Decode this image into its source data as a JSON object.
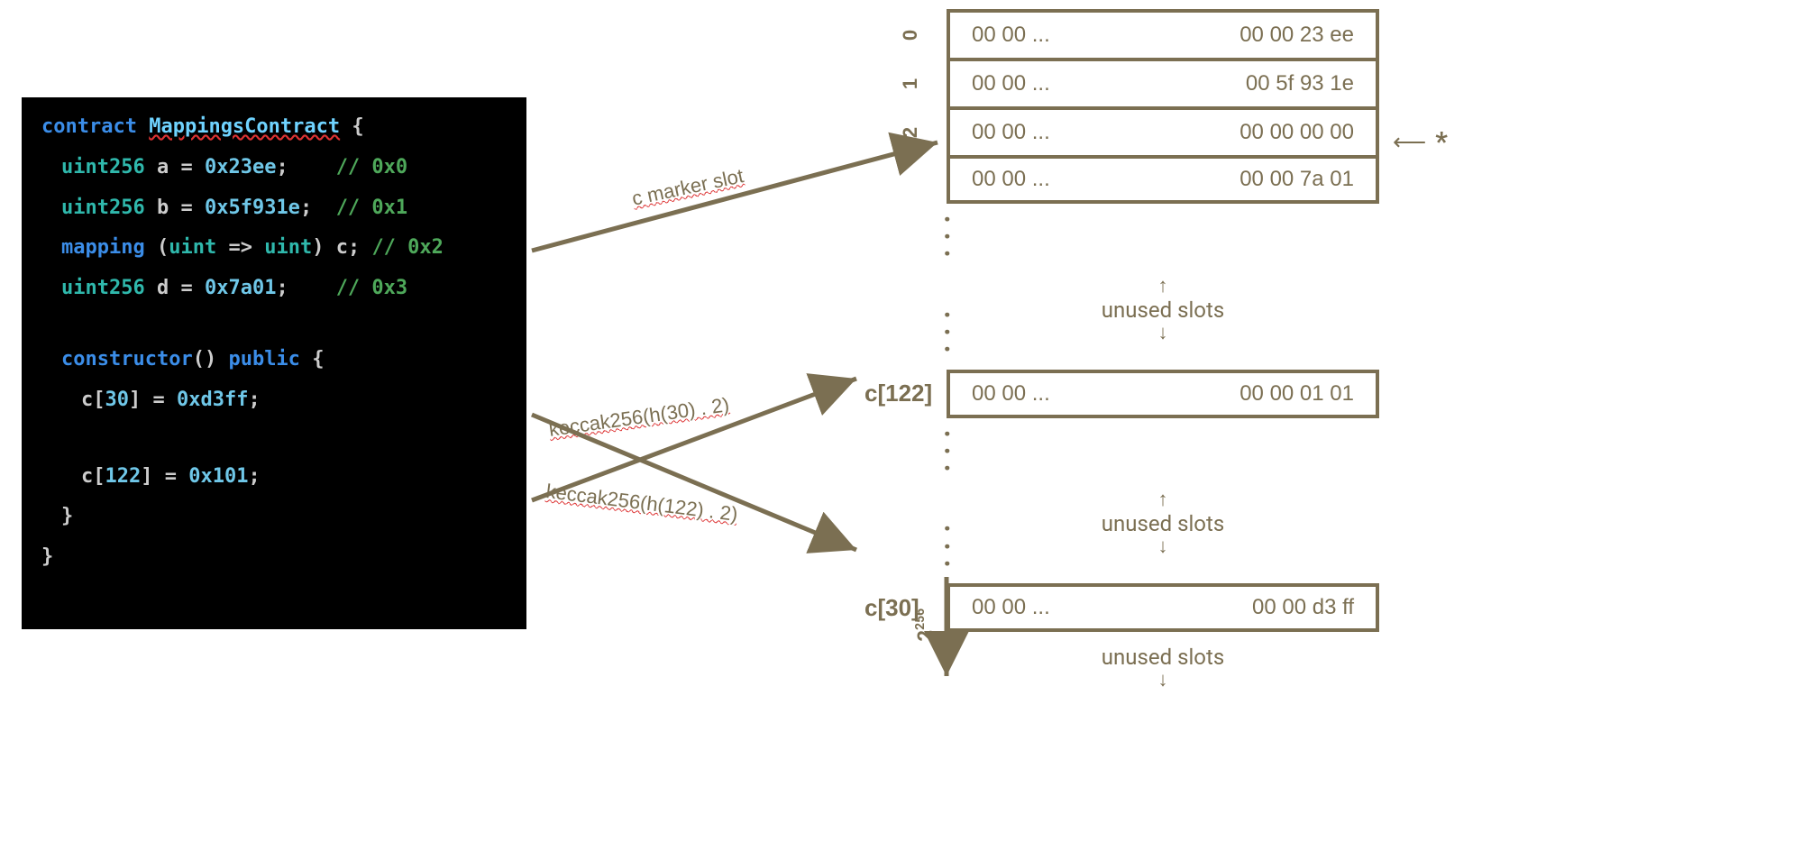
{
  "code": {
    "line1_kw": "contract",
    "line1_name": "MappingsContract",
    "line1_brace": "{",
    "line2_type": "uint256",
    "line2_ident": "a",
    "line2_eq": "=",
    "line2_val": "0x23ee",
    "line2_semi": ";",
    "line2_comment": "// 0x0",
    "line3_type": "uint256",
    "line3_ident": "b",
    "line3_eq": "=",
    "line3_val": "0x5f931e",
    "line3_semi": ";",
    "line3_comment": "// 0x1",
    "line4_kw": "mapping",
    "line4_paren_open": "(",
    "line4_t1": "uint",
    "line4_arrow": "=>",
    "line4_t2": "uint",
    "line4_paren_close": ")",
    "line4_ident": "c",
    "line4_semi": ";",
    "line4_comment": "// 0x2",
    "line5_type": "uint256",
    "line5_ident": "d",
    "line5_eq": "=",
    "line5_val": "0x7a01",
    "line5_semi": ";",
    "line5_comment": "// 0x3",
    "line6_kw": "constructor",
    "line6_parens": "()",
    "line6_mod": "public",
    "line6_brace": "{",
    "line7_arr": "c",
    "line7_idx_open": "[",
    "line7_idx": "30",
    "line7_idx_close": "]",
    "line7_eq": "=",
    "line7_val": "0xd3ff",
    "line7_semi": ";",
    "line8_arr": "c",
    "line8_idx_open": "[",
    "line8_idx": "122",
    "line8_idx_close": "]",
    "line8_eq": "=",
    "line8_val": "0x101",
    "line8_semi": ";",
    "line9_brace": "}",
    "line10_brace": "}"
  },
  "slots": {
    "r0_left": "00 00 ...",
    "r0_right": "00 00 23 ee",
    "r0_label": "0",
    "r1_left": "00 00 ...",
    "r1_right": "00 5f 93 1e",
    "r1_label": "1",
    "r2_left": "00 00 ...",
    "r2_right": "00 00 00 00",
    "r2_label": "2",
    "r3_left": "00 00 ...",
    "r3_right": "00 00 7a 01",
    "c122_label": "c[122]",
    "c122_left": "00 00 ...",
    "c122_right": "00 00 01 01",
    "c30_label": "c[30]",
    "c30_left": "00 00 ...",
    "c30_right": "00 00 d3 ff",
    "unused": "unused slots",
    "axis_end": "2",
    "axis_end_sup": "256",
    "star": "*"
  },
  "labels": {
    "marker": "c marker slot",
    "keccak1": "keccak256(h(30) . 2)",
    "keccak2": "keccak256(h(122) . 2)"
  }
}
